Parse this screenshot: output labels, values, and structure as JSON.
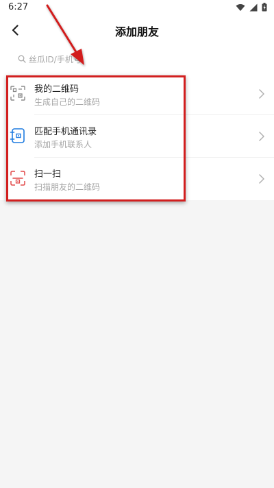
{
  "status_bar": {
    "time": "6:27"
  },
  "header": {
    "title": "添加朋友"
  },
  "search": {
    "placeholder": "丝瓜ID/手机号"
  },
  "items": [
    {
      "icon": "qr-code-icon",
      "title": "我的二维码",
      "subtitle": "生成自己的二维码",
      "icon_color": "#888888"
    },
    {
      "icon": "contacts-icon",
      "title": "匹配手机通讯录",
      "subtitle": "添加手机联系人",
      "icon_color": "#1e7be0"
    },
    {
      "icon": "scan-icon",
      "title": "扫一扫",
      "subtitle": "扫描朋友的二维码",
      "icon_color": "#e24a4a"
    }
  ],
  "colors": {
    "annotation_red": "#d21f1f"
  }
}
